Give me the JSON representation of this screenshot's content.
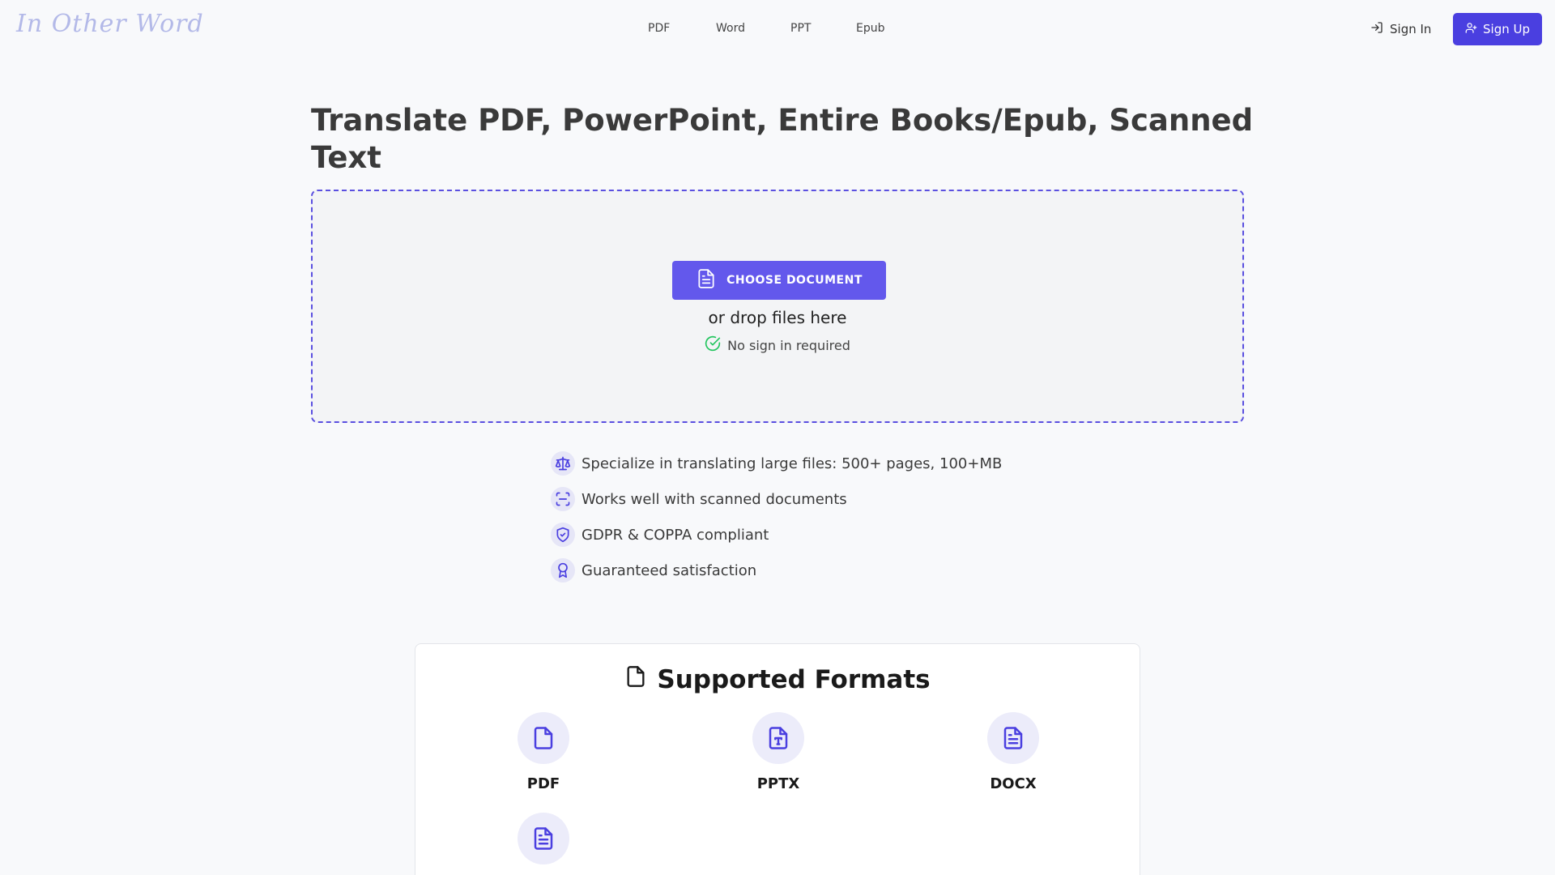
{
  "header": {
    "logo": "In Other Word",
    "nav": [
      {
        "label": "PDF"
      },
      {
        "label": "Word"
      },
      {
        "label": "PPT"
      },
      {
        "label": "Epub"
      }
    ],
    "sign_in": "Sign In",
    "sign_up": "Sign Up"
  },
  "hero": {
    "title": "Translate PDF, PowerPoint, Entire Books/Epub, Scanned Text",
    "choose_button": "CHOOSE DOCUMENT",
    "drop_text": "or drop files here",
    "no_sign_in": "No sign in required"
  },
  "features": [
    {
      "text": "Specialize in translating large files: 500+ pages, 100+MB",
      "icon": "scale-icon"
    },
    {
      "text": "Works well with scanned documents",
      "icon": "scan-icon"
    },
    {
      "text": "GDPR & COPPA compliant",
      "icon": "shield-check-icon"
    },
    {
      "text": "Guaranteed satisfaction",
      "icon": "award-icon"
    }
  ],
  "formats": {
    "title": "Supported Formats",
    "items": [
      {
        "label": "PDF",
        "icon": "file-icon"
      },
      {
        "label": "PPTX",
        "icon": "file-type-icon"
      },
      {
        "label": "DOCX",
        "icon": "file-text-icon"
      },
      {
        "label": "",
        "icon": "file-text-icon"
      }
    ]
  },
  "colors": {
    "accent": "#4a3fe0",
    "button": "#6358ec",
    "check": "#22c55e",
    "logo": "#b3b9e8"
  }
}
